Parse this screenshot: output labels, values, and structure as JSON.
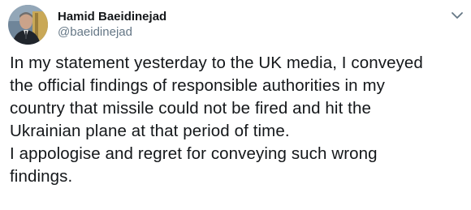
{
  "author": {
    "name": "Hamid Baeidinejad",
    "handle": "@baeidinejad"
  },
  "tweet": {
    "lines": [
      "In my statement yesterday to the UK media, I conveyed",
      "the official findings of responsible authorities in my",
      "country that missile could not be fired and hit the",
      "Ukrainian plane at that period of time.",
      "I appologise and regret for conveying such wrong",
      "findings."
    ]
  },
  "icons": {
    "avatar": "profile-photo",
    "menu": "chevron-down-icon"
  },
  "colors": {
    "text": "#14171a",
    "secondary": "#657786",
    "caret": "#657786"
  }
}
